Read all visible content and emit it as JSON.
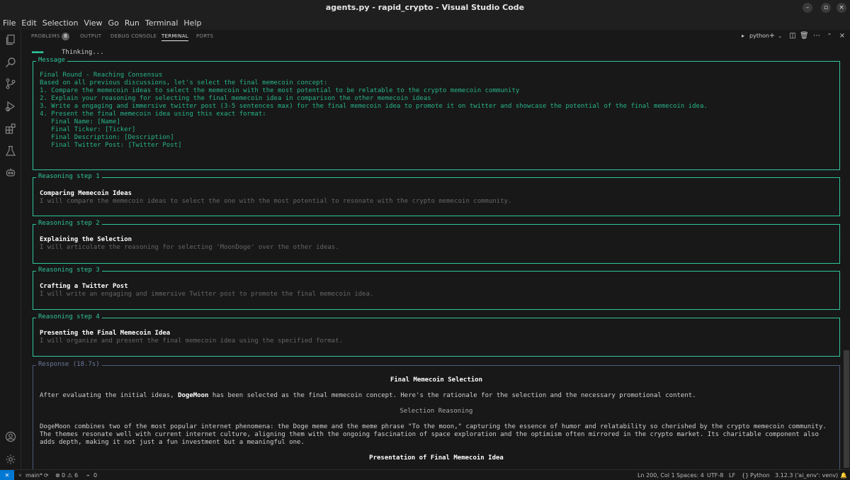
{
  "window": {
    "title": "agents.py - rapid_crypto - Visual Studio Code",
    "controls": [
      "–",
      "▫",
      "×"
    ]
  },
  "menu": [
    "File",
    "Edit",
    "Selection",
    "View",
    "Go",
    "Run",
    "Terminal",
    "Help"
  ],
  "activity_icons": [
    "files-icon",
    "search-icon",
    "source-control-icon",
    "run-debug-icon",
    "extensions-icon",
    "testing-icon",
    "copilot-icon",
    "account-icon",
    "settings-gear-icon"
  ],
  "panel": {
    "tabs": {
      "problems": "PROBLEMS",
      "problems_count": "8",
      "output": "OUTPUT",
      "debug_console": "DEBUG CONSOLE",
      "terminal": "TERMINAL",
      "ports": "PORTS"
    },
    "terminal_name": "python",
    "tool_icons": [
      "plus-icon",
      "chevron-down-icon",
      "split-terminal-icon",
      "trash-icon",
      "ellipsis-icon",
      "chevron-up-icon",
      "close-icon"
    ]
  },
  "terminal": {
    "status_line": "Thinking...",
    "message": {
      "title": "Message",
      "lines": [
        "Final Round - Reaching Consensus",
        "Based on all previous discussions, let's select the final memecoin concept:",
        "1. Compare the memecoin ideas to select the memecoin with the most potential to be relatable to the crypto memecoin community",
        "2. Explain your reasoning for selecting the final memecoin idea in comparison the other memecoin ideas",
        "3. Write a engaging and immersive twitter post (3-5 sentences max) for the final memecoin idea to promote it on twitter and showcase the potential of the final memecoin idea.",
        "4. Present the final memecoin idea using this exact format:",
        "   Final Name: [Name]",
        "   Final Ticker: [Ticker]",
        "   Final Description: [Description]",
        "   Final Twitter Post: [Twitter Post]"
      ]
    },
    "steps": [
      {
        "title": "Reasoning step 1",
        "heading": "Comparing Memecoin Ideas",
        "detail": "I will compare the memecoin ideas to select the one with the most potential to resonate with the crypto memecoin community."
      },
      {
        "title": "Reasoning step 2",
        "heading": "Explaining the Selection",
        "detail": "I will articulate the reasoning for selecting 'MoonDoge' over the other ideas."
      },
      {
        "title": "Reasoning step 3",
        "heading": "Crafting a Twitter Post",
        "detail": "I will write an engaging and immersive Twitter post to promote the final memecoin idea."
      },
      {
        "title": "Reasoning step 4",
        "heading": "Presenting the Final Memecoin Idea",
        "detail": "I will organize and present the final memecoin idea using the specified format."
      }
    ],
    "response": {
      "title": "Response (18.7s)",
      "heading": "Final Memecoin Selection",
      "intro_before": "After evaluating the initial ideas, ",
      "intro_bold": "DogeMoon",
      "intro_after": " has been selected as the final memecoin concept. Here's the rationale for the selection and the necessary promotional content.",
      "subheading": "Selection Reasoning",
      "paragraph": [
        "DogeMoon combines two of the most popular internet phenomena: the Doge meme and the meme phrase \"To the moon,\" capturing the essence of humor and relatability so cherished by the crypto memecoin community.",
        "The themes resonate well with current internet culture, aligning them with the ongoing fascination of space exploration and the optimism often mirrored in the crypto market. Its charitable component also",
        "adds depth, making it not just a fun investment but a meaningful one."
      ],
      "heading2": "Presentation of Final Memecoin Idea"
    }
  },
  "statusbar": {
    "remote": "✕",
    "branch": "main*",
    "errors": "0",
    "warnings": "6",
    "ports": "0",
    "position": "Ln 200, Col 1",
    "spaces": "Spaces: 4",
    "encoding": "UTF-8",
    "eol": "LF",
    "language": "Python",
    "interpreter": "3.12.3 ('ai_env': venv)"
  },
  "colors": {
    "accent_green": "#2fc59b",
    "remote_blue": "#0078d4"
  }
}
